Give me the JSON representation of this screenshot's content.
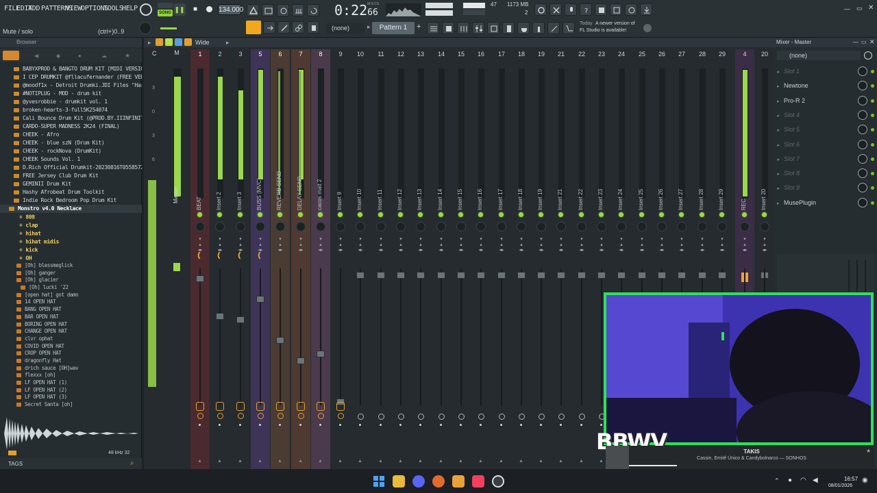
{
  "menu": [
    "FILE",
    "EDIT",
    "ADD",
    "PATTERNS",
    "VIEW",
    "OPTIONS",
    "TOOLS",
    "HELP"
  ],
  "transport": {
    "mode": "SONG",
    "tempo": "134.000",
    "time": "0:22",
    "time_ms": "66",
    "time_unit": "M:S:CS",
    "cpu": "47",
    "memory": "1173 MB",
    "poly": "2"
  },
  "hint": {
    "text": "Mute / solo",
    "shortcut": "(ctrl+)0..9"
  },
  "toolbar2": {
    "none_label": "(none)",
    "pattern": "Pattern 1",
    "news_date": "Today",
    "news_text_1": "A newer version of",
    "news_text_2": "FL Studio is available!"
  },
  "browser": {
    "title": "Browser",
    "items": [
      "BABYXPROD & BANGTO DRUM KIT [MIDI VERSION]",
      "I CEP DRUMKIT @fllacufernander (FREE VERSION)",
      "@moodf1x - Detroit Drumki.JDI Files \"Hard Times\"",
      "#NOTIPLUG - MOD - drum kit",
      "@yvesrobbie - drumkit vol. 1",
      "broken-hearts-3-full5K254074",
      "Cali Bounce Drum Kit (@PROD.BY.IIINFINITE)",
      "CARDO-SUPER MADNESS 2K24 (FINAL)",
      "CHEEK - Afro",
      "CHEEK - blue szN (Drum Kit)",
      "CHEEK - rockNova (DrumKit)",
      "CHEEK Sounds Vol. 1",
      "D.Rich Official Drumkit-20230816T055857Z-001",
      "FREE Jersey Club Drum Kit",
      "GEMINII Drum Kit",
      "Hashy Afrobeat Drum Toolkit",
      "Indie Rock Bedroom Pop Drum Kit",
      "Monstro v4.0 Necklace"
    ],
    "subfolders": [
      "808",
      "clap",
      "hihat",
      "hihat midis",
      "kick",
      "OH"
    ],
    "files": [
      "[Oh] blessmeglick",
      "[Oh] ganger",
      "[Oh] glacier",
      "[Oh] lucki '22",
      "[open hat] got damn",
      "14 OPEN HAT",
      "BANG OPEN HAT",
      "BAR OPEN HAT",
      "BORING OPEN HAT",
      "CHANGE OPEN HAT",
      "clvr ophat",
      "COVID OPEN HAT",
      "CROP OPEN HAT",
      "dragonfly Hat",
      "drich sauce [OH]wav",
      "flexxx [oh]",
      "LF OPEN HAT (1)",
      "LF OPEN HAT (2)",
      "LF OPEN HAT (3)",
      "Secret Santa [oh]"
    ],
    "sample_info": "48 kHz 32",
    "tags_label": "TAGS"
  },
  "mixer": {
    "title": "Mixer - Master",
    "view_mode": "Wide",
    "master_label": "Master",
    "header_letters": [
      "C",
      "M"
    ],
    "db_ticks": [
      "3",
      "0",
      "3",
      "6"
    ],
    "tracks": [
      {
        "num": "1",
        "name": "BEAT"
      },
      {
        "num": "2",
        "name": "Insert 2"
      },
      {
        "num": "3",
        "name": "Insert 3"
      },
      {
        "num": "5",
        "name": "BUSS (MVC)"
      },
      {
        "num": "6",
        "name": "REVERB SEND"
      },
      {
        "num": "7",
        "name": "DELAY SEND"
      },
      {
        "num": "8",
        "name": "cacos matt 2"
      },
      {
        "num": "9",
        "name": "Insert 9"
      },
      {
        "num": "10",
        "name": "Insert 10"
      },
      {
        "num": "11",
        "name": "Insert 11"
      },
      {
        "num": "12",
        "name": "Insert 12"
      },
      {
        "num": "13",
        "name": "Insert 13"
      },
      {
        "num": "14",
        "name": "Insert 14"
      },
      {
        "num": "15",
        "name": "Insert 15"
      },
      {
        "num": "16",
        "name": "Insert 16"
      },
      {
        "num": "17",
        "name": "Insert 17"
      },
      {
        "num": "18",
        "name": "Insert 18"
      },
      {
        "num": "19",
        "name": "Insert 19"
      },
      {
        "num": "21",
        "name": "Insert 21"
      },
      {
        "num": "22",
        "name": "Insert 22"
      },
      {
        "num": "23",
        "name": "Insert 23"
      },
      {
        "num": "24",
        "name": "Insert 24"
      },
      {
        "num": "25",
        "name": "Insert 25"
      },
      {
        "num": "26",
        "name": "Insert 26"
      },
      {
        "num": "27",
        "name": "Insert 27"
      },
      {
        "num": "28",
        "name": "Insert 28"
      },
      {
        "num": "29",
        "name": "Insert 29"
      }
    ],
    "rec_track": {
      "num": "4",
      "name": "REC"
    },
    "insert20": {
      "num": "20",
      "name": "Insert 20"
    }
  },
  "mixer_panel": {
    "input": "(none)",
    "slots": [
      "Slot 1",
      "Newtone",
      "Pro-R 2",
      "Slot 4",
      "Slot 5",
      "Slot 6",
      "Slot 7",
      "Slot 8",
      "Slot 9"
    ],
    "post_slot": "MusePlugin"
  },
  "overlay": {
    "brand": "BBWV",
    "np_title": "TAKIS",
    "np_artist": "Cassin, Emitê Único & Candybolnarco — SONHOS"
  },
  "taskbar": {
    "time": "16:57",
    "date": "08/01/2026"
  },
  "colors": {
    "accent_green": "#9bd84a",
    "accent_orange": "#e0a030",
    "webcam_border": "#2fe05a"
  }
}
